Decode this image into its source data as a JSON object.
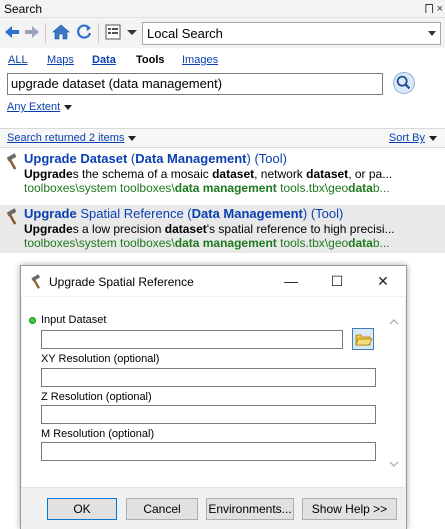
{
  "pane": {
    "title": "Search",
    "pin_glyph": "⨅ ×"
  },
  "toolbar": {
    "back_icon": "back-arrow-icon",
    "forward_icon": "forward-arrow-icon",
    "home_icon": "home-icon",
    "refresh_icon": "refresh-icon",
    "view_icon": "view-options-icon",
    "location": "Local Search"
  },
  "tabs": [
    {
      "label": "ALL"
    },
    {
      "label": "Maps"
    },
    {
      "label": "Data"
    },
    {
      "label": "Tools"
    },
    {
      "label": "Images"
    }
  ],
  "search": {
    "query": "upgrade dataset (data management)",
    "extent": "Any Extent"
  },
  "results_bar": {
    "count_text": "Search returned 2 items",
    "sort_text": "Sort By"
  },
  "results": [
    {
      "title_a": "Upgrade Dataset",
      "title_b": " (",
      "title_c": "Data Management",
      "title_d": ") (Tool)",
      "desc_a": "Upgrade",
      "desc_b": "s the schema of a mosaic ",
      "desc_c": "dataset",
      "desc_d": ", network ",
      "desc_e": "dataset",
      "desc_f": ", or pa...",
      "path_a": "toolboxes\\system toolboxes\\",
      "path_b": "data management",
      "path_c": " tools.tbx\\geo",
      "path_d": "data",
      "path_e": "b..."
    },
    {
      "title_a": "Upgrade",
      "title_b": " Spatial Reference (",
      "title_c": "Data Management",
      "title_d": ") (Tool)",
      "desc_a": "Upgrade",
      "desc_b": "s a low precision ",
      "desc_c": "dataset",
      "desc_d": "'s spatial reference to high precisi...",
      "path_a": "toolboxes\\system toolboxes\\",
      "path_b": "data management",
      "path_c": " tools.tbx\\geo",
      "path_d": "data",
      "path_e": "b..."
    }
  ],
  "dialog": {
    "title": "Upgrade Spatial Reference",
    "minimize": "—",
    "maximize": "☐",
    "close": "✕",
    "fields": [
      {
        "label": "Input Dataset",
        "value": ""
      },
      {
        "label": "XY Resolution (optional)",
        "value": ""
      },
      {
        "label": "Z Resolution (optional)",
        "value": ""
      },
      {
        "label": "M Resolution (optional)",
        "value": ""
      }
    ],
    "buttons": {
      "ok": "OK",
      "cancel": "Cancel",
      "environments": "Environments...",
      "help": "Show Help >>"
    }
  },
  "colors": {
    "link": "#0a3fb3",
    "path_green": "#1e7a1e",
    "required_dot": "#3ad13a"
  }
}
